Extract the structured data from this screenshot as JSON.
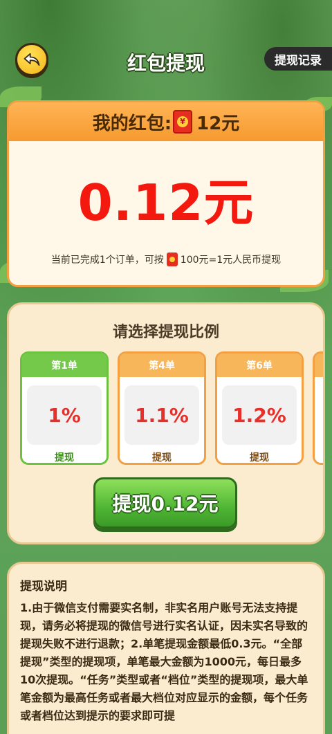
{
  "header": {
    "back_icon": "back-arrow-icon",
    "title": "红包提现",
    "record_label": "提现记录"
  },
  "wallet": {
    "label_prefix": "我的红包:",
    "balance": "12元",
    "amount": "0.12元",
    "note_prefix": "当前已完成1个订单，可按",
    "note_suffix": "100元=1元人民币提现"
  },
  "ratio": {
    "title": "请选择提现比例",
    "options": [
      {
        "head": "第1单",
        "value": "1%",
        "label": "提现",
        "selected": true
      },
      {
        "head": "第4单",
        "value": "1.1%",
        "label": "提现",
        "selected": false
      },
      {
        "head": "第6单",
        "value": "1.2%",
        "label": "提现",
        "selected": false
      }
    ],
    "withdraw_button": "提现0.12元"
  },
  "instructions": {
    "title": "提现说明",
    "text": "1.由于微信支付需要实名制，非实名用户账号无法支持提现，请务必将提现的微信号进行实名认证，因未实名导致的提现失败不进行退款；2.单笔提现金额最低0.3元。“全部提现”类型的提现项，单笔最大金额为1000元，每日最多10次提现。“任务”类型或者“档位”类型的提现项，最大单笔金额为最高任务或者最大档位对应显示的金额，每个任务或者档位达到提示的要求即可提"
  },
  "colors": {
    "accent_orange": "#f3a042",
    "amount_red": "#f3190e",
    "button_green": "#4fb634"
  }
}
